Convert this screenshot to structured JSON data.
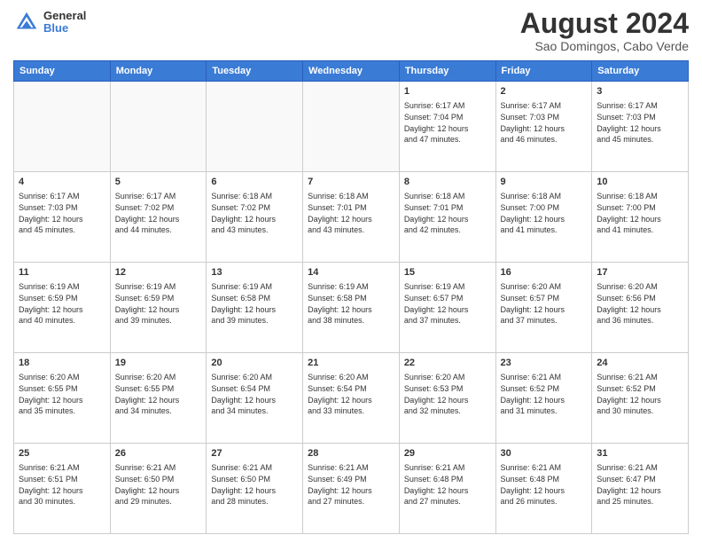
{
  "header": {
    "logo_line1": "General",
    "logo_line2": "Blue",
    "month_title": "August 2024",
    "location": "Sao Domingos, Cabo Verde"
  },
  "days_of_week": [
    "Sunday",
    "Monday",
    "Tuesday",
    "Wednesday",
    "Thursday",
    "Friday",
    "Saturday"
  ],
  "weeks": [
    [
      {
        "num": "",
        "info": ""
      },
      {
        "num": "",
        "info": ""
      },
      {
        "num": "",
        "info": ""
      },
      {
        "num": "",
        "info": ""
      },
      {
        "num": "1",
        "info": "Sunrise: 6:17 AM\nSunset: 7:04 PM\nDaylight: 12 hours\nand 47 minutes."
      },
      {
        "num": "2",
        "info": "Sunrise: 6:17 AM\nSunset: 7:03 PM\nDaylight: 12 hours\nand 46 minutes."
      },
      {
        "num": "3",
        "info": "Sunrise: 6:17 AM\nSunset: 7:03 PM\nDaylight: 12 hours\nand 45 minutes."
      }
    ],
    [
      {
        "num": "4",
        "info": "Sunrise: 6:17 AM\nSunset: 7:03 PM\nDaylight: 12 hours\nand 45 minutes."
      },
      {
        "num": "5",
        "info": "Sunrise: 6:17 AM\nSunset: 7:02 PM\nDaylight: 12 hours\nand 44 minutes."
      },
      {
        "num": "6",
        "info": "Sunrise: 6:18 AM\nSunset: 7:02 PM\nDaylight: 12 hours\nand 43 minutes."
      },
      {
        "num": "7",
        "info": "Sunrise: 6:18 AM\nSunset: 7:01 PM\nDaylight: 12 hours\nand 43 minutes."
      },
      {
        "num": "8",
        "info": "Sunrise: 6:18 AM\nSunset: 7:01 PM\nDaylight: 12 hours\nand 42 minutes."
      },
      {
        "num": "9",
        "info": "Sunrise: 6:18 AM\nSunset: 7:00 PM\nDaylight: 12 hours\nand 41 minutes."
      },
      {
        "num": "10",
        "info": "Sunrise: 6:18 AM\nSunset: 7:00 PM\nDaylight: 12 hours\nand 41 minutes."
      }
    ],
    [
      {
        "num": "11",
        "info": "Sunrise: 6:19 AM\nSunset: 6:59 PM\nDaylight: 12 hours\nand 40 minutes."
      },
      {
        "num": "12",
        "info": "Sunrise: 6:19 AM\nSunset: 6:59 PM\nDaylight: 12 hours\nand 39 minutes."
      },
      {
        "num": "13",
        "info": "Sunrise: 6:19 AM\nSunset: 6:58 PM\nDaylight: 12 hours\nand 39 minutes."
      },
      {
        "num": "14",
        "info": "Sunrise: 6:19 AM\nSunset: 6:58 PM\nDaylight: 12 hours\nand 38 minutes."
      },
      {
        "num": "15",
        "info": "Sunrise: 6:19 AM\nSunset: 6:57 PM\nDaylight: 12 hours\nand 37 minutes."
      },
      {
        "num": "16",
        "info": "Sunrise: 6:20 AM\nSunset: 6:57 PM\nDaylight: 12 hours\nand 37 minutes."
      },
      {
        "num": "17",
        "info": "Sunrise: 6:20 AM\nSunset: 6:56 PM\nDaylight: 12 hours\nand 36 minutes."
      }
    ],
    [
      {
        "num": "18",
        "info": "Sunrise: 6:20 AM\nSunset: 6:55 PM\nDaylight: 12 hours\nand 35 minutes."
      },
      {
        "num": "19",
        "info": "Sunrise: 6:20 AM\nSunset: 6:55 PM\nDaylight: 12 hours\nand 34 minutes."
      },
      {
        "num": "20",
        "info": "Sunrise: 6:20 AM\nSunset: 6:54 PM\nDaylight: 12 hours\nand 34 minutes."
      },
      {
        "num": "21",
        "info": "Sunrise: 6:20 AM\nSunset: 6:54 PM\nDaylight: 12 hours\nand 33 minutes."
      },
      {
        "num": "22",
        "info": "Sunrise: 6:20 AM\nSunset: 6:53 PM\nDaylight: 12 hours\nand 32 minutes."
      },
      {
        "num": "23",
        "info": "Sunrise: 6:21 AM\nSunset: 6:52 PM\nDaylight: 12 hours\nand 31 minutes."
      },
      {
        "num": "24",
        "info": "Sunrise: 6:21 AM\nSunset: 6:52 PM\nDaylight: 12 hours\nand 30 minutes."
      }
    ],
    [
      {
        "num": "25",
        "info": "Sunrise: 6:21 AM\nSunset: 6:51 PM\nDaylight: 12 hours\nand 30 minutes."
      },
      {
        "num": "26",
        "info": "Sunrise: 6:21 AM\nSunset: 6:50 PM\nDaylight: 12 hours\nand 29 minutes."
      },
      {
        "num": "27",
        "info": "Sunrise: 6:21 AM\nSunset: 6:50 PM\nDaylight: 12 hours\nand 28 minutes."
      },
      {
        "num": "28",
        "info": "Sunrise: 6:21 AM\nSunset: 6:49 PM\nDaylight: 12 hours\nand 27 minutes."
      },
      {
        "num": "29",
        "info": "Sunrise: 6:21 AM\nSunset: 6:48 PM\nDaylight: 12 hours\nand 27 minutes."
      },
      {
        "num": "30",
        "info": "Sunrise: 6:21 AM\nSunset: 6:48 PM\nDaylight: 12 hours\nand 26 minutes."
      },
      {
        "num": "31",
        "info": "Sunrise: 6:21 AM\nSunset: 6:47 PM\nDaylight: 12 hours\nand 25 minutes."
      }
    ]
  ]
}
